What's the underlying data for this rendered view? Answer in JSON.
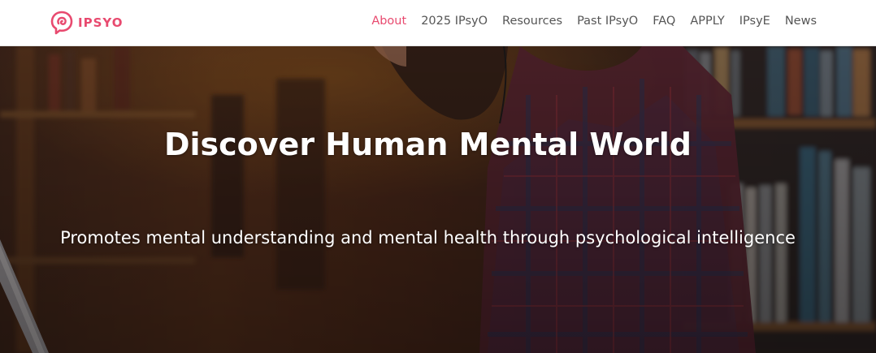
{
  "brand": {
    "name": "IPSYO",
    "accent_color": "#e84a6f",
    "logo_icon": "brain-speech-bubble-icon"
  },
  "nav": {
    "items": [
      {
        "label": "About",
        "active": true
      },
      {
        "label": "2025 IPsyO",
        "active": false
      },
      {
        "label": "Resources",
        "active": false
      },
      {
        "label": "Past IPsyO",
        "active": false
      },
      {
        "label": "FAQ",
        "active": false
      },
      {
        "label": "APPLY",
        "active": false
      },
      {
        "label": "IPsyE",
        "active": false
      },
      {
        "label": "News",
        "active": false
      }
    ]
  },
  "hero": {
    "title": "Discover Human Mental World",
    "subtitle": "Promotes mental understanding and mental health through psychological intelligence"
  }
}
